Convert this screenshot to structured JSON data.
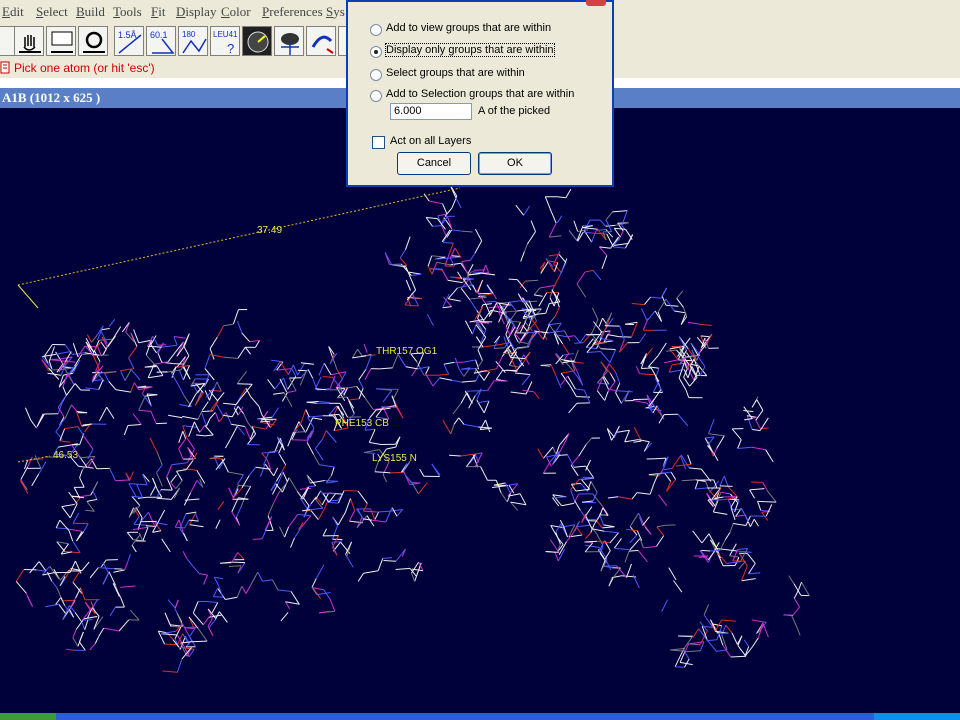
{
  "menu": [
    "Edit",
    "Select",
    "Build",
    "Tools",
    "Fit",
    "Display",
    "Color",
    "Preferences",
    "Sys"
  ],
  "toolbar_icons": [
    "radius-1.5-label-icon",
    "angle-60-icon",
    "dihedral-icon",
    "leu41-identify-icon",
    "picker-gauge-icon",
    "sphere-select-icon",
    "move-icon",
    "hand-icon",
    "monitor-icon",
    "rotate-icon"
  ],
  "toolbar_text": {
    "dist": "1.5Å",
    "angle": "60.1",
    "dihedral": "180",
    "ident": "LEU41",
    "ident_q": "?"
  },
  "status": {
    "message": "Pick one atom (or hit 'esc')"
  },
  "viewer": {
    "title": "A1B  (1012 x 625 )",
    "background": "#00003a"
  },
  "labels": {
    "dist_top": "37.49",
    "dist_left": "46.53",
    "thr": "THR157   OG1",
    "phe": "PHE153   CB",
    "lys": "LYS155   N"
  },
  "dialog": {
    "options": [
      {
        "label": "Add to view groups that are within",
        "selected": false
      },
      {
        "label": "Display only groups that are within",
        "selected": true
      },
      {
        "label": "Select groups that are within",
        "selected": false
      },
      {
        "label": "Add to Selection groups that are within",
        "selected": false
      }
    ],
    "distance_value": "6.000",
    "distance_unit": "A of the picked",
    "act_all_layers_label": "Act on all Layers",
    "act_all_layers_checked": false,
    "cancel_label": "Cancel",
    "ok_label": "OK"
  },
  "colors": {
    "label_yellow": "#e8e84a",
    "bond_white": "#f0f0f0",
    "bond_blue": "#4a5cff",
    "bond_red": "#e03020",
    "bond_magenta": "#d030d0",
    "bond_grey": "#7a7a7a"
  }
}
